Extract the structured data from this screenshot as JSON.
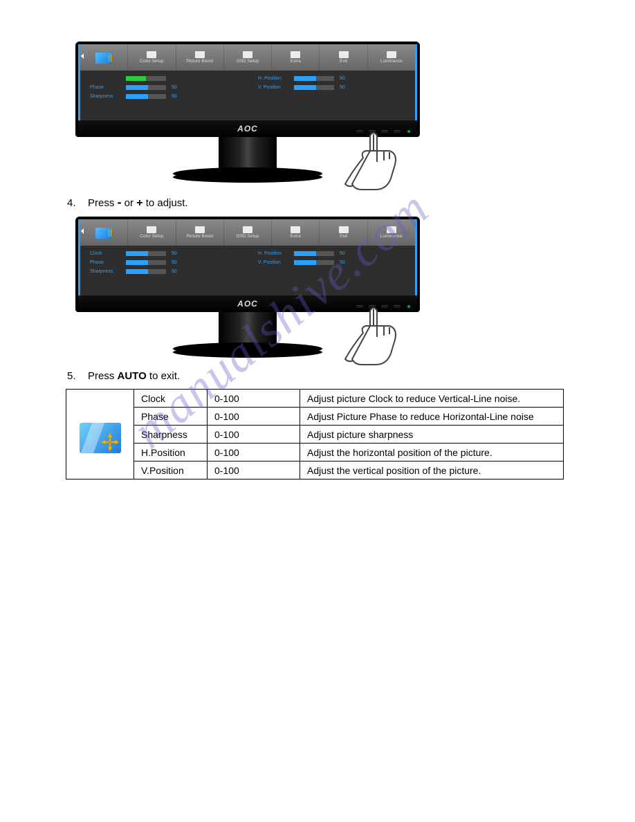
{
  "watermark": "manualshive.com",
  "steps": [
    {
      "num": "4.",
      "prefix": "Press ",
      "minus": "-",
      "mid": " or ",
      "plus": "+",
      "suffix": " to adjust."
    },
    {
      "num": "5.",
      "prefix": "Press ",
      "auto": "AUTO",
      "suffix": " to exit."
    }
  ],
  "monitor_logo": "AOC",
  "osd": {
    "tabs": [
      "",
      "Color Setup",
      "Picture Boost",
      "OSD Setup",
      "Extra",
      "Exit",
      "Luminance"
    ],
    "fig1": {
      "left": [
        {
          "label": "",
          "val": "",
          "style": "top"
        },
        {
          "label": "Phase",
          "val": "50",
          "style": "blue"
        },
        {
          "label": "Sharpness",
          "val": "50",
          "style": "blue"
        }
      ],
      "right": [
        {
          "label": "H. Position",
          "val": "50",
          "style": "blue"
        },
        {
          "label": "V. Position",
          "val": "50",
          "style": "blue"
        }
      ]
    },
    "fig2": {
      "left": [
        {
          "label": "Clock",
          "val": "50",
          "style": "blue"
        },
        {
          "label": "Phase",
          "val": "50",
          "style": "blue"
        },
        {
          "label": "Sharpness",
          "val": "50",
          "style": "blue"
        }
      ],
      "right": [
        {
          "label": "H. Position",
          "val": "50",
          "style": "blue"
        },
        {
          "label": "V. Position",
          "val": "50",
          "style": "blue"
        }
      ]
    }
  },
  "table": {
    "rows": [
      {
        "name": "Clock",
        "range": "0-100",
        "desc": "Adjust picture Clock to reduce Vertical-Line noise."
      },
      {
        "name": "Phase",
        "range": "0-100",
        "desc": "Adjust Picture Phase to reduce Horizontal-Line noise"
      },
      {
        "name": "Sharpness",
        "range": "0-100",
        "desc": "Adjust picture sharpness"
      },
      {
        "name": "H.Position",
        "range": "0-100",
        "desc": "Adjust the horizontal position of the picture."
      },
      {
        "name": "V.Position",
        "range": "0-100",
        "desc": "Adjust the vertical position of the picture."
      }
    ]
  }
}
